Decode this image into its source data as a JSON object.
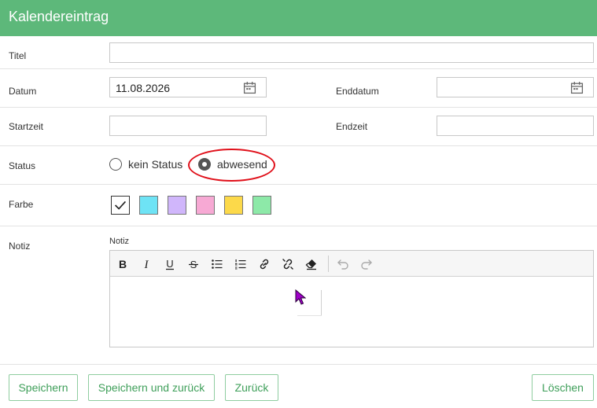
{
  "header": {
    "title": "Kalendereintrag"
  },
  "form": {
    "titel_label": "Titel",
    "titel_value": "",
    "datum_label": "Datum",
    "datum_value": "11.08.2026",
    "enddatum_label": "Enddatum",
    "enddatum_value": "",
    "startzeit_label": "Startzeit",
    "startzeit_value": "",
    "endzeit_label": "Endzeit",
    "endzeit_value": "",
    "status_label": "Status",
    "status_options": [
      {
        "label": "kein Status",
        "checked": false
      },
      {
        "label": "abwesend",
        "checked": true
      }
    ],
    "farbe_label": "Farbe",
    "colors": [
      {
        "hex": "#ffffff",
        "selected": true
      },
      {
        "hex": "#6ee3f5",
        "selected": false
      },
      {
        "hex": "#d0b6fb",
        "selected": false
      },
      {
        "hex": "#f7a9d4",
        "selected": false
      },
      {
        "hex": "#fcd94a",
        "selected": false
      },
      {
        "hex": "#8de9a8",
        "selected": false
      }
    ],
    "notiz_label": "Notiz",
    "notiz_editor_label": "Notiz",
    "notiz_value": ""
  },
  "editor": {
    "tools": [
      "bold-icon",
      "italic-icon",
      "underline-icon",
      "strikethrough-icon",
      "bullet-list-icon",
      "numbered-list-icon",
      "link-icon",
      "unlink-icon",
      "eraser-icon",
      "undo-icon",
      "redo-icon"
    ]
  },
  "buttons": {
    "save": "Speichern",
    "save_back": "Speichern und zurück",
    "back": "Zurück",
    "delete": "Löschen"
  },
  "colors": {
    "header_bg": "#5db87a",
    "button_text": "#3f9f5a",
    "highlight": "#e0101a",
    "cursor": "#a000c8"
  }
}
